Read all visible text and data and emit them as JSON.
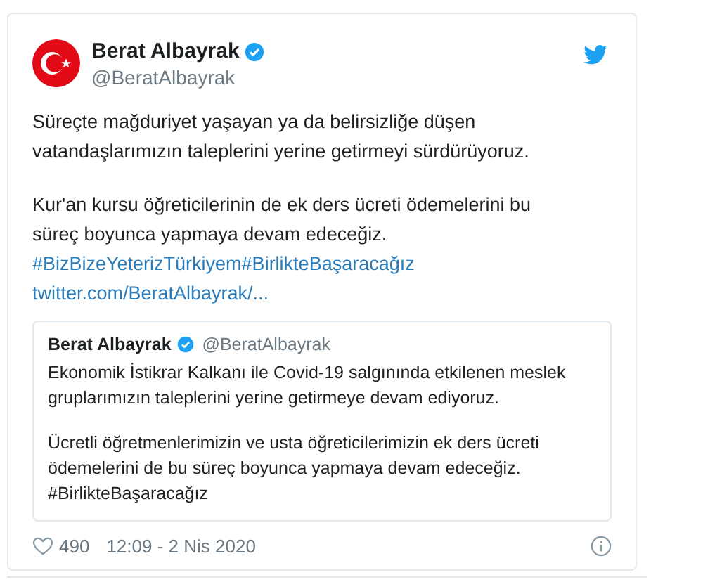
{
  "tweet": {
    "author": {
      "name": "Berat Albayrak",
      "handle": "@BeratAlbayrak",
      "verified": true
    },
    "paragraphs": [
      "Süreçte mağduriyet yaşayan ya da belirsizliğe düşen\nvatandaşlarımızın taleplerini yerine getirmeyi sürdürüyoruz.",
      "Kur'an kursu öğreticilerinin de ek ders ücreti ödemelerini bu\nsüreç boyunca yapmaya devam edeceğiz."
    ],
    "hashtags": "#BizBizeYeterizTürkiyem#BirlikteBaşaracağız",
    "link": "twitter.com/BeratAlbayrak/...",
    "quoted": {
      "name": "Berat Albayrak",
      "handle": "@BeratAlbayrak",
      "verified": true,
      "paragraphs": [
        "Ekonomik İstikrar Kalkanı ile Covid-19 salgınında etkilenen meslek\ngruplarımızın taleplerini yerine getirmeye devam ediyoruz.",
        "Ücretli öğretmenlerimizin ve usta öğreticilerimizin ek ders ücreti\nödemelerini de bu süreç boyunca yapmaya devam edeceğiz.\n#BirlikteBaşaracağız"
      ]
    },
    "likes": "490",
    "timestamp": "12:09 - 2 Nis 2020"
  }
}
